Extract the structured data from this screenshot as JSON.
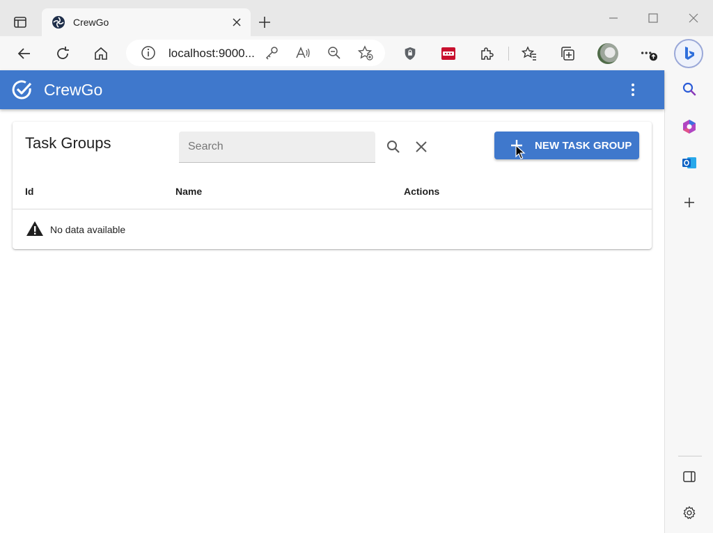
{
  "browser": {
    "tab": {
      "title": "CrewGo"
    },
    "address": {
      "url": "localhost:9000..."
    }
  },
  "app": {
    "title": "CrewGo"
  },
  "task_groups": {
    "title": "Task Groups",
    "search": {
      "placeholder": "Search",
      "value": ""
    },
    "new_button_label": "NEW TASK GROUP",
    "columns": [
      "Id",
      "Name",
      "Actions"
    ],
    "empty_message": "No data available"
  },
  "colors": {
    "primary": "#3f78cc",
    "chrome": "#f7f7f7",
    "tabstrip": "#e8e8e8"
  }
}
